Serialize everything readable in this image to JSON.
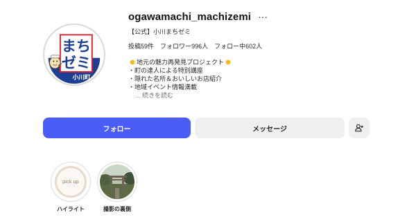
{
  "profile": {
    "username": "ogawamachi_machizemi",
    "full_name": "【公式】小川まちゼミ",
    "logo_text": {
      "top": "まち",
      "middle": "ゼミ",
      "bottom": "小川町"
    },
    "stats": [
      {
        "label": "投稿",
        "value": "59",
        "unit": "件"
      },
      {
        "label": "フォロワー",
        "value": "996",
        "unit": "人"
      },
      {
        "label": "フォロー中",
        "value": "602",
        "unit": "人"
      }
    ],
    "bio": [
      "地元の魅力再発見プロジェクト",
      "・町の達人による特別講座",
      "・隠れた名所＆おいしいお店紹介",
      "・地域イベント情報満載"
    ],
    "more_link": "... 続きを読む"
  },
  "actions": {
    "follow_label": "フォロー",
    "message_label": "メッセージ"
  },
  "highlights": [
    {
      "label": "ハイライト",
      "cover_text": "pick up"
    },
    {
      "label": "撮影の裏側"
    }
  ],
  "colors": {
    "follow_button": "#4a5df9",
    "logo_blue": "#1d3f93",
    "logo_red": "#d8262f",
    "secondary_button": "#efefef"
  },
  "icons": {
    "more": "more-horizontal-icon",
    "suggest": "add-person-icon",
    "emoji": "sun-icon"
  }
}
